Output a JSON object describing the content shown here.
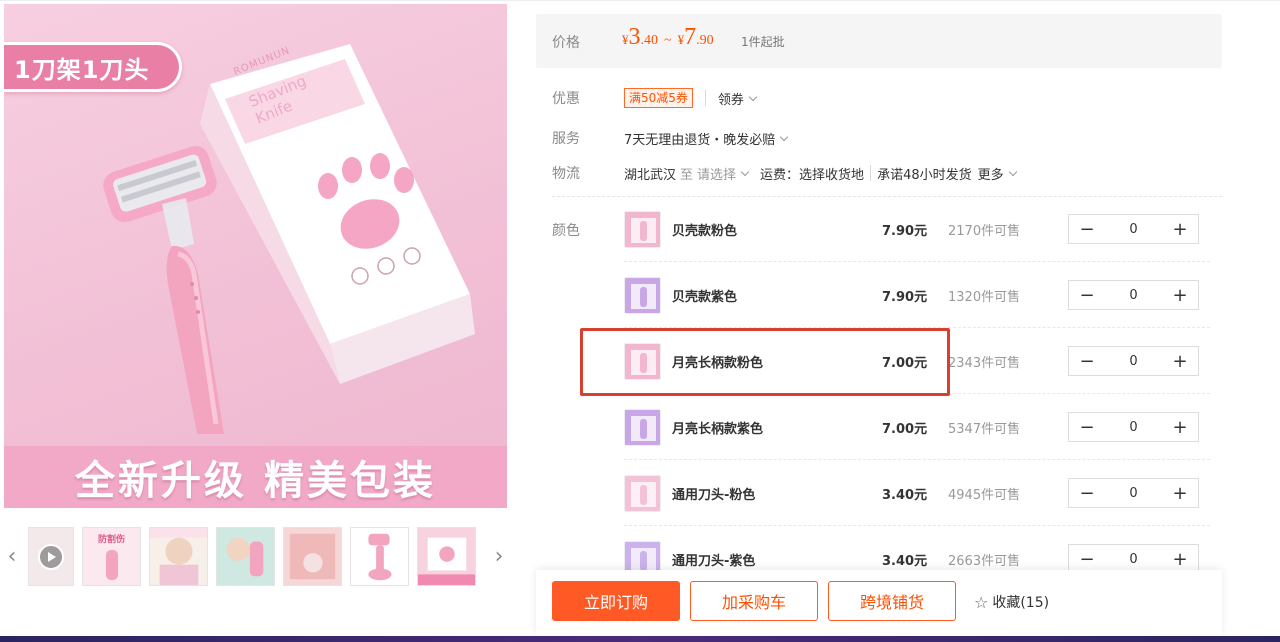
{
  "gallery": {
    "badge": "1刀架1刀头",
    "banner": "全新升级 精美包装",
    "box_brand": "ROMUNUN",
    "box_title": "Shaving\nKnife",
    "thumbs": [
      {
        "name": "thumb-video",
        "kind": "video"
      },
      {
        "name": "thumb-2",
        "kind": "image",
        "caption": "防割伤"
      },
      {
        "name": "thumb-3",
        "kind": "image"
      },
      {
        "name": "thumb-4",
        "kind": "image"
      },
      {
        "name": "thumb-5",
        "kind": "image"
      },
      {
        "name": "thumb-6",
        "kind": "image"
      },
      {
        "name": "thumb-7",
        "kind": "image"
      }
    ]
  },
  "price": {
    "label": "价格",
    "low_yen": "¥",
    "low_int": "3",
    "low_dec": ".40",
    "tilde": "~",
    "high_yen": "¥",
    "high_int": "7",
    "high_dec": ".90",
    "moq": "1件起批"
  },
  "promo": {
    "label": "优惠",
    "coupon": "满50减5券",
    "get_coupon": "领券"
  },
  "service": {
    "label": "服务",
    "text": "7天无理由退货・晚发必赔"
  },
  "logistics": {
    "label": "物流",
    "origin": "湖北武汉",
    "to": "至",
    "select": "请选择",
    "fee": "运费：选择收货地",
    "promise": "承诺48小时发货",
    "more": "更多"
  },
  "sku": {
    "label": "颜色",
    "items": [
      {
        "name": "贝壳款粉色",
        "price": "7.90元",
        "stock": "2170件可售",
        "qty": "0",
        "tone": "#f2b6cf"
      },
      {
        "name": "贝壳款紫色",
        "price": "7.90元",
        "stock": "1320件可售",
        "qty": "0",
        "tone": "#c9a6e6"
      },
      {
        "name": "月亮长柄款粉色",
        "price": "7.00元",
        "stock": "2343件可售",
        "qty": "0",
        "tone": "#f2b6cf"
      },
      {
        "name": "月亮长柄款紫色",
        "price": "7.00元",
        "stock": "5347件可售",
        "qty": "0",
        "tone": "#c9a6e6"
      },
      {
        "name": "通用刀头-粉色",
        "price": "3.40元",
        "stock": "4945件可售",
        "qty": "0",
        "tone": "#f4c2d6"
      },
      {
        "name": "通用刀头-紫色",
        "price": "3.40元",
        "stock": "2663件可售",
        "qty": "0",
        "tone": "#cbb2ec"
      }
    ],
    "minus": "−",
    "plus": "+"
  },
  "actions": {
    "buy_now": "立即订购",
    "add_cart": "加采购车",
    "cross_border": "跨境铺货",
    "favorite": "收藏(15)",
    "star_icon": "☆"
  },
  "colors": {
    "accent": "#ff5a26",
    "highlight": "#d6402d",
    "pink": "#f1a9c7"
  }
}
